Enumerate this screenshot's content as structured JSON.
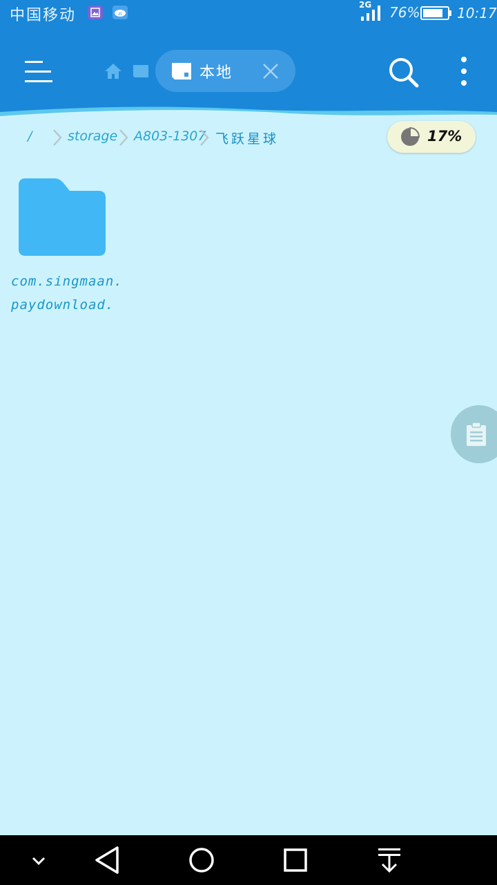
{
  "status_bar": {
    "carrier": "中国移动",
    "network": "2G",
    "battery_percent": "76%",
    "time": "10:17",
    "icons": [
      "gallery-icon",
      "cloud-download-icon",
      "signal-icon",
      "battery-icon"
    ]
  },
  "header": {
    "active_tab": {
      "label": "本地",
      "icon": "sd-card-icon"
    },
    "icons": [
      "menu-icon",
      "home-icon",
      "sd-card-icon",
      "close-icon",
      "search-icon",
      "more-vert-icon"
    ]
  },
  "breadcrumb": {
    "items": [
      "/",
      "storage",
      "A803-1307",
      "飞跃星球"
    ]
  },
  "storage_usage": {
    "label": "17%",
    "percent": 17
  },
  "files": [
    {
      "name": "com.singmaan.paydownload.",
      "type": "folder"
    }
  ],
  "nav_bar": {
    "buttons": [
      "chevron-down-icon",
      "back-icon",
      "home-circle-icon",
      "recents-icon",
      "pull-down-icon"
    ]
  },
  "colors": {
    "header": "#1a87d8",
    "background": "#ccf3fd",
    "folder": "#41b8f5",
    "text_accent": "#2aa4cf"
  }
}
